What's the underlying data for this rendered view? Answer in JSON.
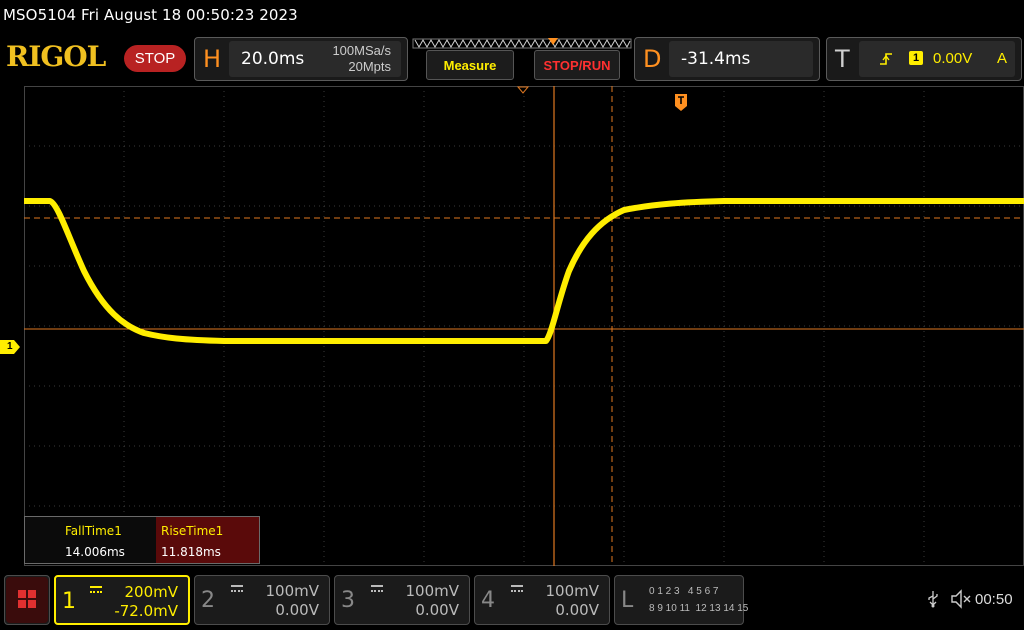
{
  "status_line": "MSO5104  Fri August 18 00:50:23 2023",
  "brand": "RIGOL",
  "run_state": "STOP",
  "horizontal": {
    "tag": "H",
    "timebase": "20.0ms",
    "sample_rate": "100MSa/s",
    "memory_depth": "20Mpts"
  },
  "buttons": {
    "measure": "Measure",
    "stop_run": "STOP/RUN"
  },
  "delay": {
    "tag": "D",
    "value": "-31.4ms"
  },
  "trigger": {
    "tag": "T",
    "source": "1",
    "level": "0.00V",
    "mode": "A"
  },
  "channel_marker": "1",
  "measurements": {
    "fall_label": "FallTime1",
    "fall_value": "14.006ms",
    "rise_label": "RiseTime1",
    "rise_value": "11.818ms"
  },
  "channels": [
    {
      "num": "1",
      "scale": "200mV",
      "offset": "-72.0mV",
      "active": true
    },
    {
      "num": "2",
      "scale": "100mV",
      "offset": "0.00V",
      "active": false
    },
    {
      "num": "3",
      "scale": "100mV",
      "offset": "0.00V",
      "active": false
    },
    {
      "num": "4",
      "scale": "100mV",
      "offset": "0.00V",
      "active": false
    }
  ],
  "logic": {
    "tag": "L",
    "row1": "0 1 2 3   4 5 6 7",
    "row2": "8 9 10 11  12 13 14 15"
  },
  "system_time": "00:50",
  "colors": {
    "ch1": "#ffee00",
    "accent": "#ff9020",
    "stop": "#b82222",
    "grid": "#3a3a3a"
  }
}
